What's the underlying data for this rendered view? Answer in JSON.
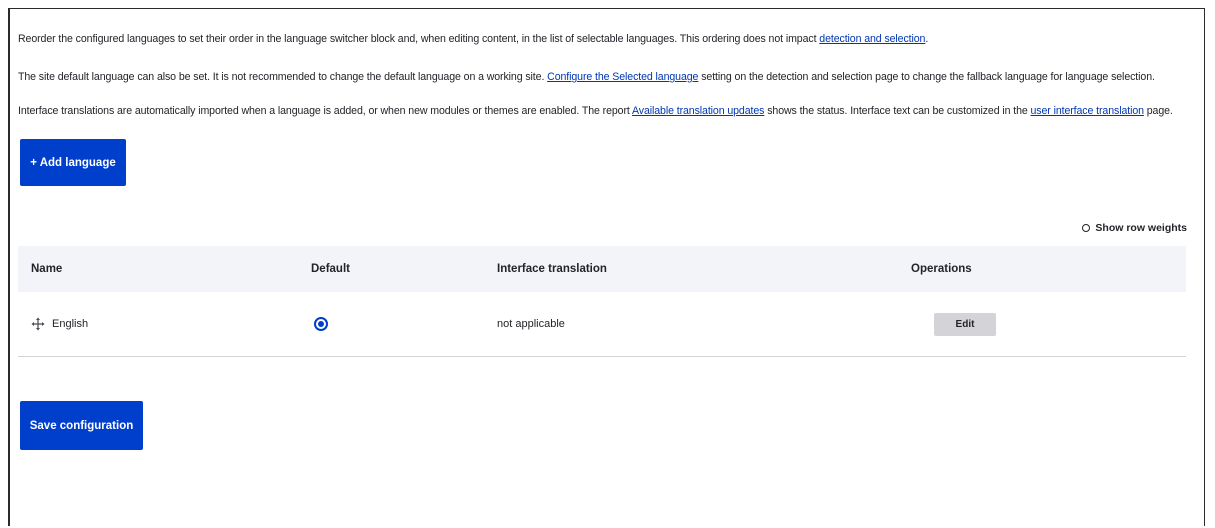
{
  "intro": {
    "p1": {
      "text": "Reorder the configured languages to set their order in the language switcher block and, when editing content, in the list of selectable languages. This ordering does not impact ",
      "link": "detection and selection",
      "tail": "."
    },
    "p2": {
      "text": "The site default language can also be set. It is not recommended to change the default language on a working site. ",
      "link": "Configure the Selected language",
      "tail": " setting on the detection and selection page to change the fallback language for language selection."
    },
    "p3": {
      "text": "Interface translations are automatically imported when a language is added, or when new modules or themes are enabled. The report ",
      "link1": "Available translation updates",
      "mid": " shows the status. Interface text can be customized in the ",
      "link2": "user interface translation",
      "tail": " page."
    }
  },
  "add_language_label": "+ Add language",
  "show_row_weights_label": "Show row weights",
  "table": {
    "headers": [
      "Name",
      "Default",
      "Interface translation",
      "Operations"
    ],
    "rows": [
      {
        "name": "English",
        "default_selected": true,
        "interface_translation": "not applicable",
        "operation": "Edit"
      }
    ]
  },
  "save_label": "Save configuration",
  "colors": {
    "primary": "#003ecc",
    "link": "#0036b1",
    "header_bg": "#f3f4f9"
  }
}
